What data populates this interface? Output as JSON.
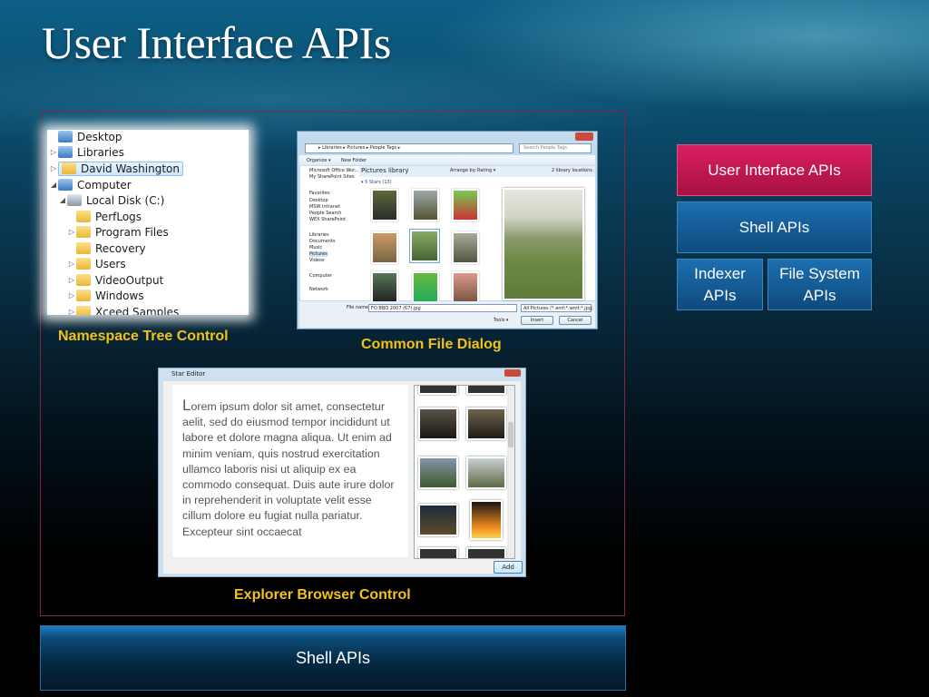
{
  "slide": {
    "title": "User Interface APIs"
  },
  "tree": {
    "items": [
      "Desktop",
      "Libraries",
      "David Washington",
      "Computer",
      "Local Disk (C:)",
      "PerfLogs",
      "Program Files",
      "Recovery",
      "Users",
      "VideoOutput",
      "Windows",
      "Xceed Samples"
    ],
    "caption": "Namespace Tree Control"
  },
  "file_dialog": {
    "caption": "Common File Dialog",
    "address": "▸ Libraries ▸ Pictures ▸ People Tags ▸",
    "search_placeholder": "Search People Tags",
    "toolbar": [
      "Organize ▾",
      "New Folder"
    ],
    "nav": [
      "Microsoft Office Wor...",
      "My SharePoint Sites",
      "Favorites",
      "Desktop",
      "MSW Intranet",
      "People Search",
      "WEX SharePoint",
      "Libraries",
      "Documents",
      "Music",
      "Pictures",
      "Videos",
      "Computer",
      "Network"
    ],
    "library_title": "Pictures library",
    "arrange_label": "Arrange by:",
    "arrange_value": "Rating ▾",
    "locations": "2 library locations",
    "group": "▾ 5 Stars (13)",
    "file_name_label": "File name:",
    "file_name_value": "FO BBQ 2007 (67).jpg",
    "filter": "All Pictures (*.emf;*.wmf;*.jpg;",
    "tools_label": "Tools ▾",
    "insert_label": "Insert",
    "cancel_label": "Cancel"
  },
  "explorer_browser": {
    "caption": "Explorer Browser Control",
    "window_title": "Star Editor",
    "drop_cap": "L",
    "body_text": "orem ipsum dolor sit amet, consectetur aelit, sed do eiusmod tempor incididunt ut labore et dolore magna aliqua. Ut enim ad minim veniam, quis nostrud exercitation ullamco laboris nisi ut aliquip ex ea commodo consequat. Duis aute irure dolor in reprehenderit in voluptate velit esse cillum dolore eu fugiat nulla pariatur. Excepteur sint occaecat",
    "add_label": "Add"
  },
  "stack": {
    "ui_apis": "User Interface APIs",
    "shell_apis": "Shell APIs",
    "indexer_apis": "Indexer APIs",
    "fs_apis": "File System APIs"
  },
  "bottom_bar": {
    "label": "Shell APIs"
  },
  "colors": {
    "accent_pink": "#c4174f",
    "accent_blue": "#15609c",
    "caption_yellow": "#f2c21b"
  }
}
